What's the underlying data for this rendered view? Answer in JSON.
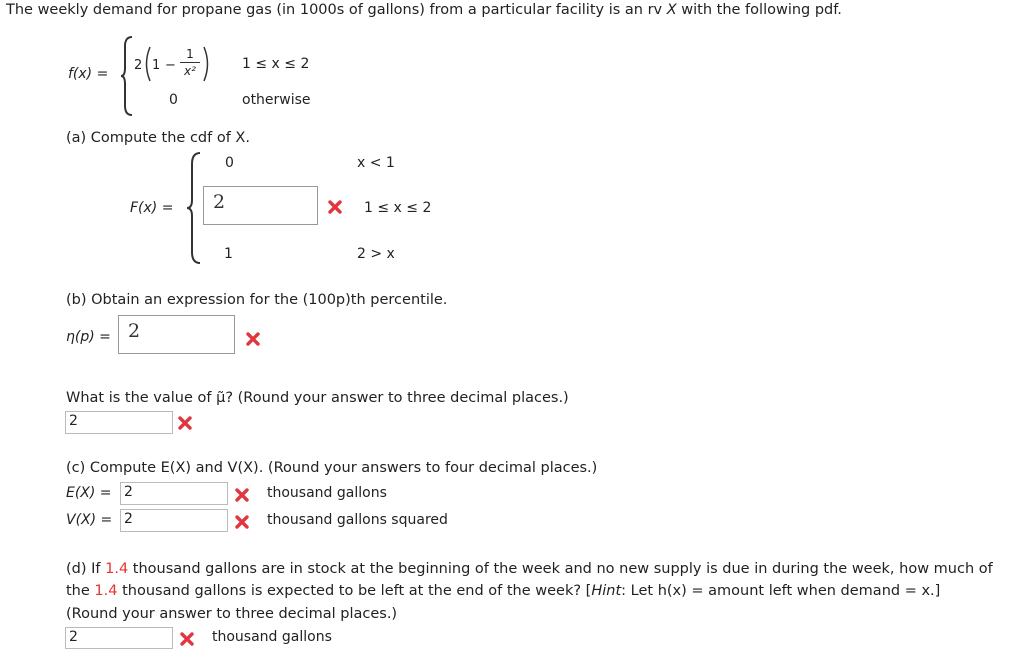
{
  "intro": {
    "text_before": "The weekly demand for propane gas (in 1000s of gallons) from a particular facility is an rv ",
    "var": "X",
    "text_after": " with the following pdf."
  },
  "pdf": {
    "label": "f(x) =",
    "case1_coef": "2",
    "case1_one": "1",
    "case1_minus": "−",
    "case1_num": "1",
    "case1_den": "x²",
    "case1_cond": "1 ≤ x ≤ 2",
    "case2_val": "0",
    "case2_cond": "otherwise"
  },
  "part_a": {
    "prompt": "(a) Compute the cdf of X.",
    "label": "F(x) =",
    "row1_val": "0",
    "row1_cond": "x < 1",
    "row2_input_value": "2",
    "row2_cond": "1 ≤ x ≤ 2",
    "row2_status": "incorrect",
    "row3_val": "1",
    "row3_cond": "2 > x"
  },
  "part_b": {
    "prompt": "(b) Obtain an expression for the (100p)th percentile.",
    "label": "η(p) =",
    "input_value": "2",
    "status": "incorrect",
    "median_prompt": "What is the value of μ̃? (Round your answer to three decimal places.)",
    "median_input_value": "2",
    "median_status": "incorrect"
  },
  "part_c": {
    "prompt": "(c) Compute E(X) and V(X). (Round your answers to four decimal places.)",
    "ex_label": "E(X) =",
    "ex_value": "2",
    "ex_unit": "thousand gallons",
    "ex_status": "incorrect",
    "vx_label": "V(X) =",
    "vx_value": "2",
    "vx_unit": "thousand gallons squared",
    "vx_status": "incorrect"
  },
  "part_d": {
    "line1_a": "(d) If ",
    "stock": "1.4",
    "line1_b": " thousand gallons are in stock at the beginning of the week and no new supply is due in during the week, how much of",
    "line2_a": "the ",
    "line2_b": " thousand gallons is expected to be left at the end of the week? [",
    "hint_word": "Hint",
    "line2_c": ": Let h(x) = amount left when demand = x.]",
    "line3": "(Round your answer to three decimal places.)",
    "input_value": "2",
    "unit": "thousand gallons",
    "status": "incorrect"
  },
  "colors": {
    "highlight": "#e2362f",
    "incorrect_mark": "#e2363f"
  }
}
